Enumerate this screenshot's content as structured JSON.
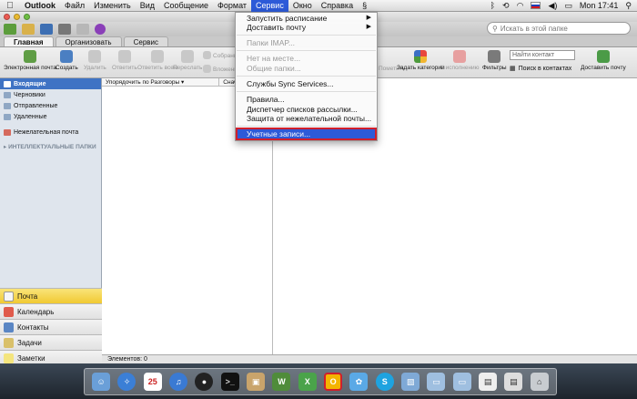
{
  "menubar": {
    "app_name": "Outlook",
    "items": [
      "Файл",
      "Изменить",
      "Вид",
      "Сообщение",
      "Формат",
      "Сервис",
      "Окно",
      "Справка"
    ],
    "active_item": "Сервис",
    "clock": "Mon 17:41"
  },
  "search": {
    "placeholder": "Искать в этой папке"
  },
  "tabs": [
    "Главная",
    "Организовать",
    "Сервис"
  ],
  "ribbon": {
    "new_email": "Электронная почта",
    "create": "Создать",
    "delete": "Удалить",
    "reply": "Ответить",
    "reply_all": "Ответить всем",
    "forward": "Переслать",
    "meeting_top": "Собрание",
    "attachment": "Вложение",
    "watch": "Пометить",
    "categorize": "Задать категории",
    "followup": "К исполнению",
    "filters": "Фильтры",
    "contact_search": "Найти контакт",
    "contact_link": "Поиск в контактах",
    "send_receive": "Доставить почту"
  },
  "folders": {
    "items": [
      "Входящие",
      "Черновики",
      "Отправленные",
      "Удаленные",
      "Нежелательная почта"
    ],
    "smart_folders": "ИНТЕЛЛЕКТУАЛЬНЫЕ ПАПКИ"
  },
  "list": {
    "sort_by": "Упорядочить по Разговоры",
    "sort_order": "Снач"
  },
  "nav": [
    "Почта",
    "Календарь",
    "Контакты",
    "Задачи",
    "Заметки"
  ],
  "status": {
    "items_count": "Элементов: 0"
  },
  "dropdown": {
    "run_schedule": "Запустить расписание",
    "send_receive": "Доставить почту",
    "imap_folders": "Папки IMAP...",
    "out_of_office": "Нет на месте...",
    "public_folders": "Общие папки...",
    "sync_services": "Службы Sync Services...",
    "rules": "Правила...",
    "mailing_list": "Диспетчер списков рассылки...",
    "junk_protection": "Защита от нежелательной почты...",
    "accounts": "Учетные записи..."
  },
  "colors": {
    "accent": "#2d5ad8",
    "highlight_border": "#d01f2b",
    "nav_selected": "#f1c932"
  }
}
